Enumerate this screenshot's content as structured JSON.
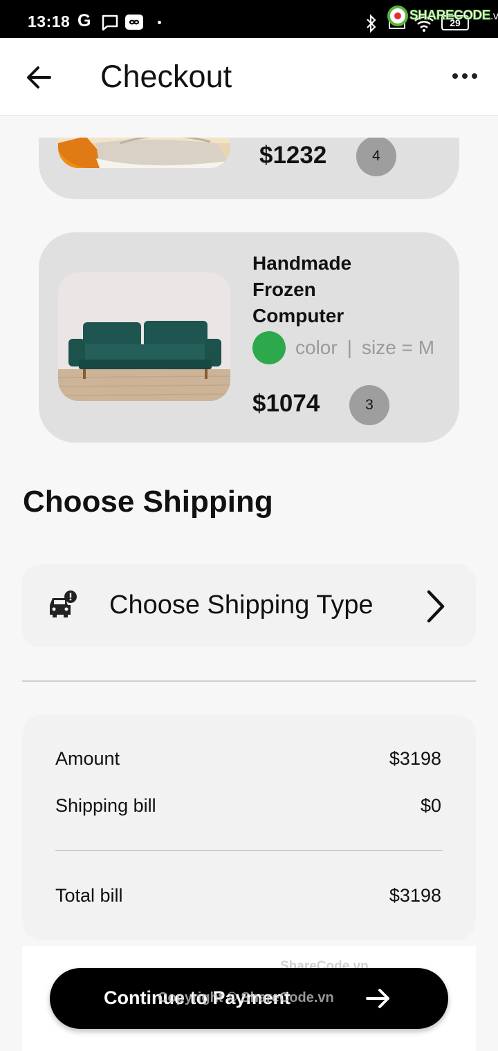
{
  "status_bar": {
    "time": "13:18",
    "g_label": "G",
    "battery": "29",
    "logo_text": "SHARECODE",
    "logo_suffix": ".vn"
  },
  "header": {
    "title": "Checkout",
    "back_icon": "arrow-left-icon",
    "menu_icon": "more-horizontal-icon"
  },
  "cart_items": [
    {
      "image": "shoe-photo",
      "price": "$1232",
      "quantity": "4"
    },
    {
      "image": "green-sofa-photo",
      "name": "Handmade Frozen Computer",
      "color_swatch": "#2ea84d",
      "color_label": "color",
      "separator": "|",
      "size_label": "size = M",
      "price": "$1074",
      "quantity": "3"
    }
  ],
  "shipping": {
    "section_title": "Choose Shipping",
    "option_label": "Choose Shipping Type",
    "option_icon": "car-alert-icon",
    "chevron_icon": "chevron-right-icon"
  },
  "bill": {
    "amount_label": "Amount",
    "amount_value": "$3198",
    "shipping_label": "Shipping bill",
    "shipping_value": "$0",
    "total_label": "Total bill",
    "total_value": "$3198"
  },
  "footer": {
    "button_label": "Continue to Payment",
    "button_icon": "arrow-right-icon",
    "watermark_top": "ShareCode.vn",
    "watermark_bottom": "Copyright © ShareCode.vn"
  },
  "colors": {
    "card_bg": "#e0e0e0",
    "button_bg": "#000000",
    "swatch_green": "#2ea84d"
  }
}
